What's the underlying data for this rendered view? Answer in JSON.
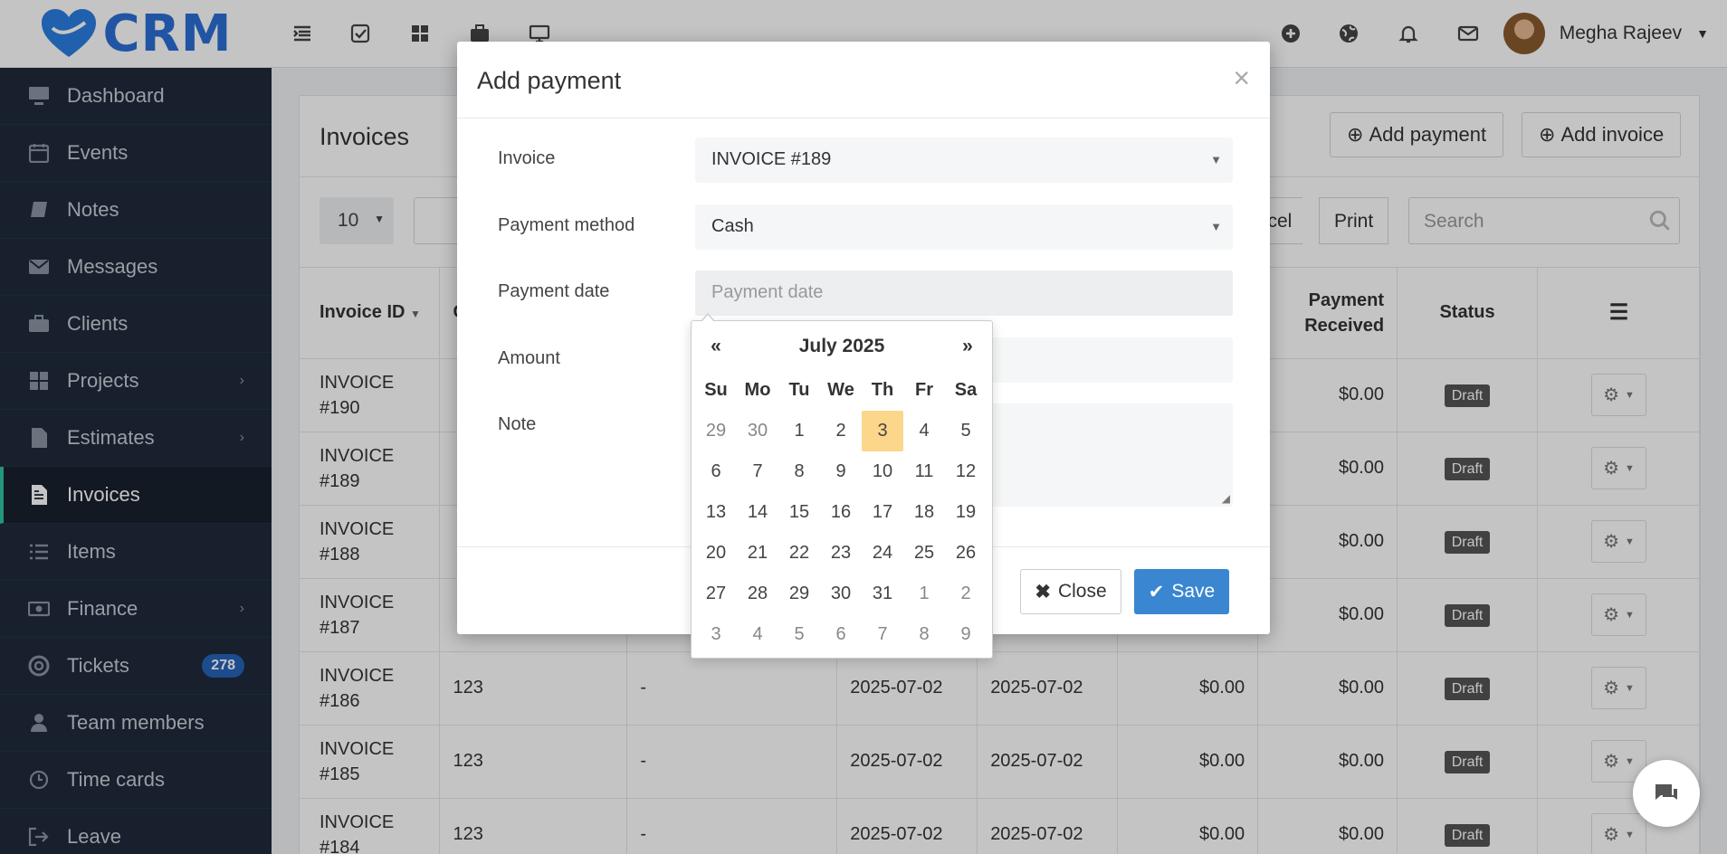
{
  "app": {
    "logo_text": "CRM",
    "user_name": "Megha Rajeev"
  },
  "sidebar": {
    "items": [
      {
        "label": "Dashboard",
        "icon": "monitor-icon"
      },
      {
        "label": "Events",
        "icon": "calendar-icon"
      },
      {
        "label": "Notes",
        "icon": "book-icon"
      },
      {
        "label": "Messages",
        "icon": "envelope-icon"
      },
      {
        "label": "Clients",
        "icon": "briefcase-icon"
      },
      {
        "label": "Projects",
        "icon": "grid-icon",
        "chevron": "›"
      },
      {
        "label": "Estimates",
        "icon": "file-icon",
        "chevron": "›"
      },
      {
        "label": "Invoices",
        "icon": "file-text-icon"
      },
      {
        "label": "Items",
        "icon": "list-icon"
      },
      {
        "label": "Finance",
        "icon": "money-icon",
        "chevron": "›"
      },
      {
        "label": "Tickets",
        "icon": "lifebuoy-icon",
        "badge": "278"
      },
      {
        "label": "Team members",
        "icon": "user-icon"
      },
      {
        "label": "Time cards",
        "icon": "clock-icon"
      },
      {
        "label": "Leave",
        "icon": "sign-out-icon"
      }
    ]
  },
  "panel": {
    "title": "Invoices",
    "add_payment": "Add payment",
    "add_invoice": "Add invoice",
    "page_size": "10",
    "excel": "xcel",
    "print": "Print",
    "search_placeholder": "Search"
  },
  "table": {
    "headers": [
      "Invoice ID",
      "C",
      "",
      "",
      "",
      "",
      "Payment Received",
      "Status",
      "☰"
    ],
    "rows": [
      {
        "id_line1": "INVOICE",
        "id_line2": "#190",
        "client": "",
        "project": "",
        "bill_date": "",
        "due_date": "",
        "total": "",
        "received": "$0.00",
        "status": "Draft"
      },
      {
        "id_line1": "INVOICE",
        "id_line2": "#189",
        "client": "",
        "project": "",
        "bill_date": "",
        "due_date": "",
        "total": "",
        "received": "$0.00",
        "status": "Draft"
      },
      {
        "id_line1": "INVOICE",
        "id_line2": "#188",
        "client": "",
        "project": "",
        "bill_date": "",
        "due_date": "",
        "total": "",
        "received": "$0.00",
        "status": "Draft"
      },
      {
        "id_line1": "INVOICE",
        "id_line2": "#187",
        "client": "",
        "project": "",
        "bill_date": "",
        "due_date": "",
        "total": "",
        "received": "$0.00",
        "status": "Draft"
      },
      {
        "id_line1": "INVOICE",
        "id_line2": "#186",
        "client": "123",
        "project": "-",
        "bill_date": "2025-07-02",
        "due_date": "2025-07-02",
        "total": "$0.00",
        "received": "$0.00",
        "status": "Draft"
      },
      {
        "id_line1": "INVOICE",
        "id_line2": "#185",
        "client": "123",
        "project": "-",
        "bill_date": "2025-07-02",
        "due_date": "2025-07-02",
        "total": "$0.00",
        "received": "$0.00",
        "status": "Draft"
      },
      {
        "id_line1": "INVOICE",
        "id_line2": "#184",
        "client": "123",
        "project": "-",
        "bill_date": "2025-07-02",
        "due_date": "2025-07-02",
        "total": "$0.00",
        "received": "$0.00",
        "status": "Draft"
      }
    ]
  },
  "modal": {
    "title": "Add payment",
    "close_x": "×",
    "fields": {
      "invoice_label": "Invoice",
      "invoice_value": "INVOICE #189",
      "method_label": "Payment method",
      "method_value": "Cash",
      "date_label": "Payment date",
      "date_placeholder": "Payment date",
      "amount_label": "Amount",
      "note_label": "Note"
    },
    "close_button": "Close",
    "save_button": "Save"
  },
  "datepicker": {
    "prev": "«",
    "next": "»",
    "month_label": "July 2025",
    "weekdays": [
      "Su",
      "Mo",
      "Tu",
      "We",
      "Th",
      "Fr",
      "Sa"
    ],
    "days": [
      [
        "29",
        "30",
        "1",
        "2",
        "3",
        "4",
        "5"
      ],
      [
        "6",
        "7",
        "8",
        "9",
        "10",
        "11",
        "12"
      ],
      [
        "13",
        "14",
        "15",
        "16",
        "17",
        "18",
        "19"
      ],
      [
        "20",
        "21",
        "22",
        "23",
        "24",
        "25",
        "26"
      ],
      [
        "27",
        "28",
        "29",
        "30",
        "31",
        "1",
        "2"
      ],
      [
        "3",
        "4",
        "5",
        "6",
        "7",
        "8",
        "9"
      ]
    ],
    "today": "3",
    "today_color": "#fcd68a"
  },
  "colors": {
    "sidebar": "#1f2a3a",
    "accent": "#2563b8",
    "save": "#3a86d1",
    "active_marker": "#2ec4a0"
  }
}
